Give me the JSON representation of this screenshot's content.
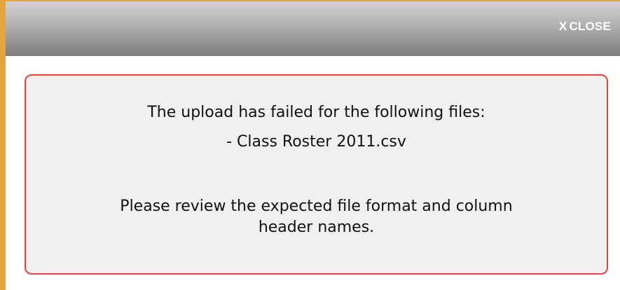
{
  "dialog": {
    "close_label": "CLOSE",
    "close_glyph": "X",
    "border_color": "#e3a53c"
  },
  "error": {
    "title": "The upload has failed for the following files:",
    "file": "- Class Roster 2011.csv",
    "instruction_line1": "Please review the expected file format and column",
    "instruction_line2": "header names.",
    "border_color": "#e84141",
    "background_color": "#f0f0f0"
  }
}
